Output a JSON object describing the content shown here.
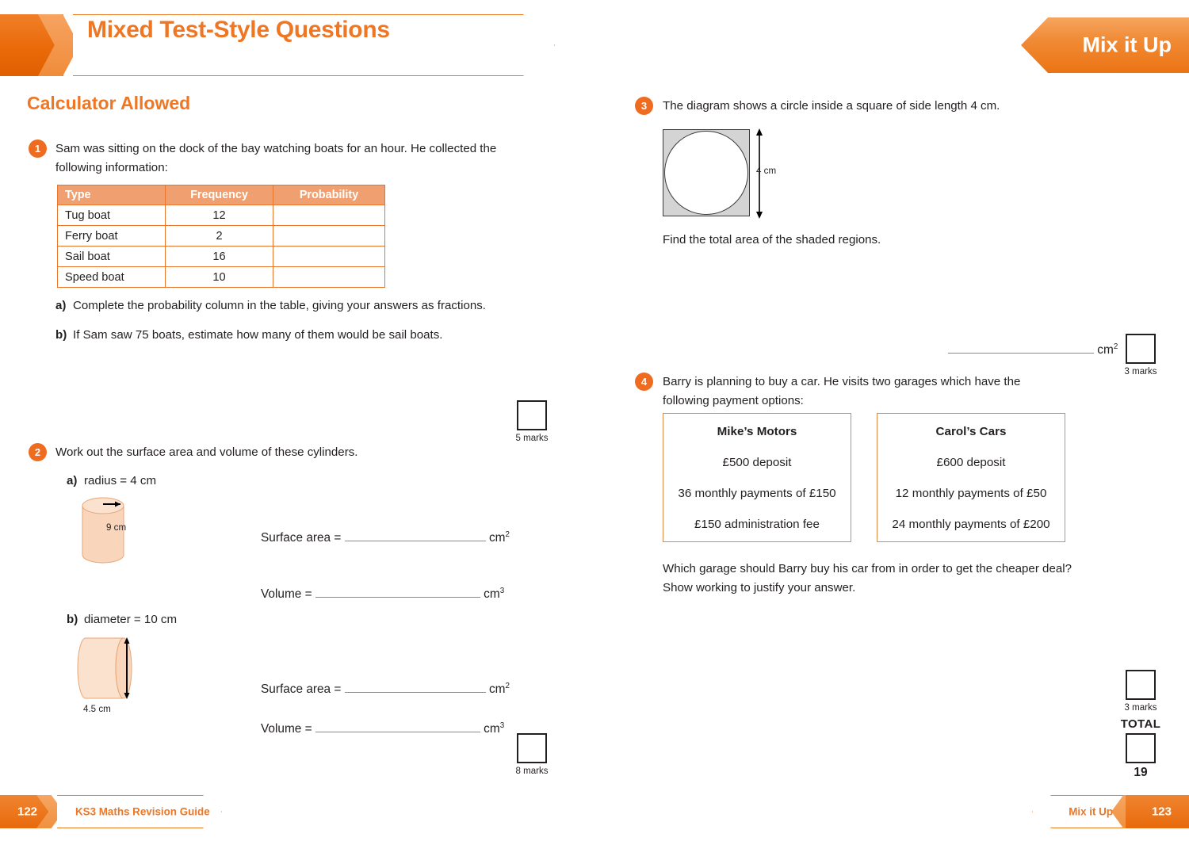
{
  "header": {
    "title": "Mixed Test-Style Questions",
    "tab_label": "Mix it Up",
    "section_title": "Calculator Allowed"
  },
  "q1": {
    "number": "1",
    "text": "Sam was sitting on the dock of the bay watching boats for an hour. He collected the following information:",
    "table": {
      "headers": [
        "Type",
        "Frequency",
        "Probability"
      ],
      "rows": [
        {
          "type": "Tug boat",
          "frequency": "12",
          "probability": ""
        },
        {
          "type": "Ferry boat",
          "frequency": "2",
          "probability": ""
        },
        {
          "type": "Sail boat",
          "frequency": "16",
          "probability": ""
        },
        {
          "type": "Speed boat",
          "frequency": "10",
          "probability": ""
        }
      ]
    },
    "part_a_label": "a)",
    "part_a": "Complete the probability column in the table, giving your answers as fractions.",
    "part_b_label": "b)",
    "part_b": "If Sam saw 75 boats, estimate how many of them would be sail boats.",
    "marks": "5 marks"
  },
  "q2": {
    "number": "2",
    "text": "Work out the surface area and volume of these cylinders.",
    "part_a_label": "a)",
    "part_a": "radius = 4 cm",
    "part_a_height": "9 cm",
    "part_b_label": "b)",
    "part_b": "diameter = 10 cm",
    "part_b_width": "4.5 cm",
    "surface_area_label": "Surface area =",
    "volume_label": "Volume =",
    "unit_area": "cm",
    "unit_area_sup": "2",
    "unit_volume": "cm",
    "unit_volume_sup": "3",
    "marks": "8 marks"
  },
  "q3": {
    "number": "3",
    "text": "The diagram shows a circle inside a square of side length 4 cm.",
    "side_label": "4 cm",
    "prompt": "Find the total area of the shaded regions.",
    "unit": "cm",
    "unit_sup": "2",
    "marks": "3 marks"
  },
  "q4": {
    "number": "4",
    "text": "Barry is planning to buy a car. He visits two garages which have the following payment options:",
    "garage_left": {
      "name": "Mike’s Motors",
      "lines": [
        "£500 deposit",
        "36 monthly payments of £150",
        "£150 administration fee"
      ]
    },
    "garage_right": {
      "name": "Carol’s Cars",
      "lines": [
        "£600 deposit",
        "12 monthly payments of £50",
        "24 monthly payments of £200"
      ]
    },
    "prompt": "Which garage should Barry buy his car from in order to get the cheaper deal? Show working to justify your answer.",
    "marks": "3 marks"
  },
  "total": {
    "label": "TOTAL",
    "value": "19"
  },
  "footer": {
    "left_page": "122",
    "left_text": "KS3 Maths Revision Guide",
    "right_text": "Mix it Up",
    "right_page": "123"
  },
  "colors": {
    "orange": "#ef7622",
    "orange_dark": "#e86a0c",
    "table_header": "#f0a070",
    "cylinder_fill": "#f9d6bb",
    "square_fill": "#d4d4d4"
  }
}
